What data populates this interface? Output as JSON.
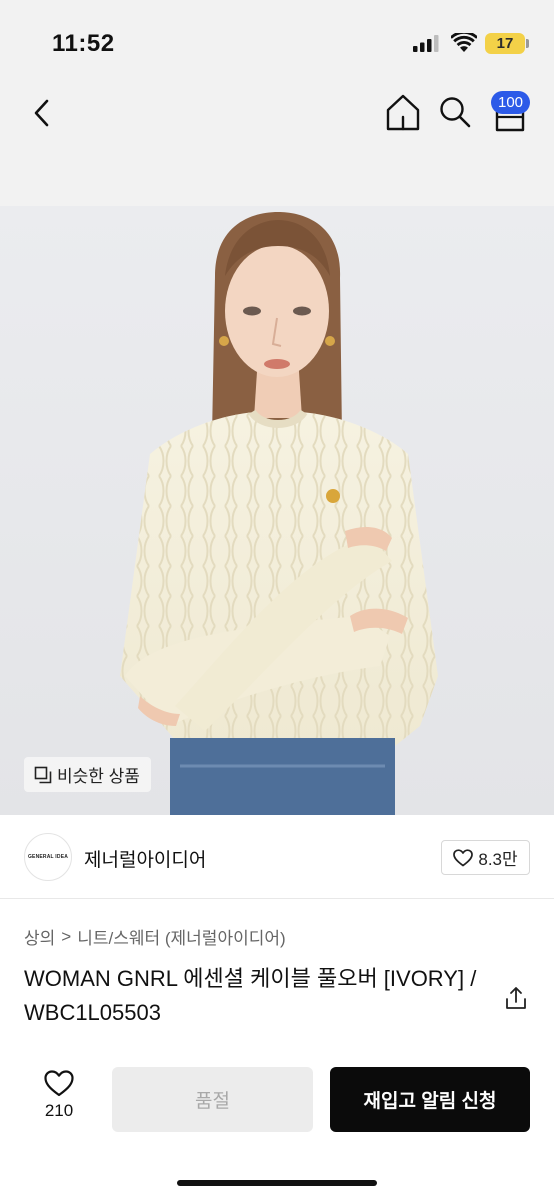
{
  "status_bar": {
    "time": "11:52",
    "battery": "17",
    "battery_color": "#f4d03f"
  },
  "nav": {
    "back_icon": "chevron-left-icon",
    "home_icon": "home-icon",
    "search_icon": "search-icon",
    "cart_icon": "cart-icon",
    "cart_count": "100",
    "badge_color": "#2c5ae8"
  },
  "hero": {
    "image": "model-wearing-ivory-cable-knit-sweater",
    "similar_label": "비슷한 상품"
  },
  "brand": {
    "logo_text": "GENERAL IDEA",
    "name": "제너럴아이디어",
    "likes": "8.3만"
  },
  "breadcrumb": {
    "category": "상의",
    "separator": ">",
    "subcategory": "니트/스웨터 (제너럴아이디어)"
  },
  "product": {
    "title": "WOMAN GNRL 에센셜 케이블 풀오버 [IVORY] / WBC1L05503"
  },
  "bottom": {
    "wish_count": "210",
    "soldout_label": "품절",
    "restock_label": "재입고 알림 신청"
  }
}
